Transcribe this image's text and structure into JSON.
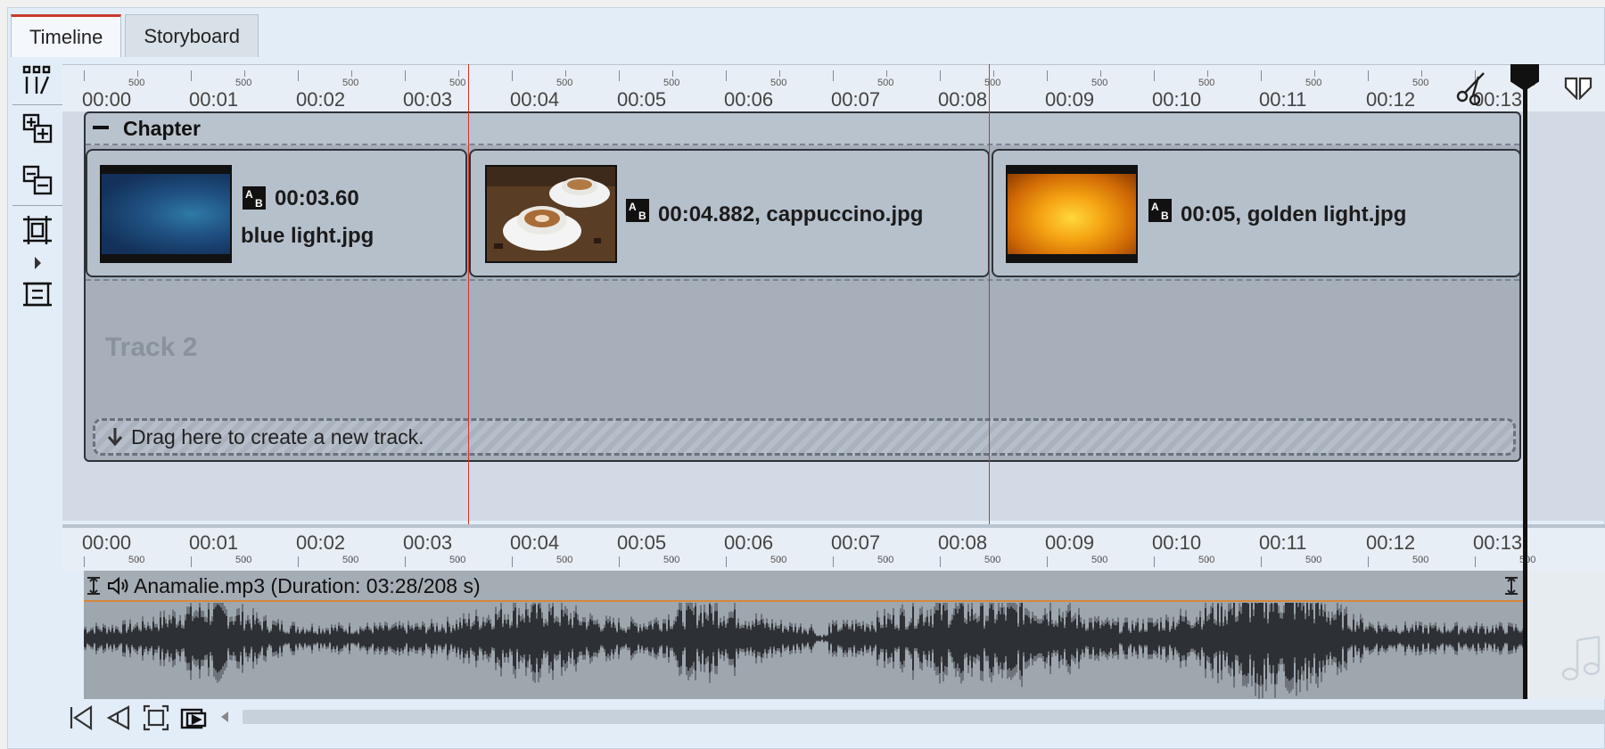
{
  "tabs": [
    {
      "label": "Timeline",
      "active": true
    },
    {
      "label": "Storyboard",
      "active": false
    }
  ],
  "ruler": {
    "labels": [
      "00:00",
      "00:01",
      "00:02",
      "00:03",
      "00:04",
      "00:05",
      "00:06",
      "00:07",
      "00:08",
      "00:09",
      "00:10",
      "00:11",
      "00:12",
      "00:13"
    ],
    "sub_label": "500"
  },
  "chapter": {
    "title": "Chapter"
  },
  "clips": [
    {
      "duration": "00:03.60",
      "name": "blue light.jpg"
    },
    {
      "label": "00:04.882, cappuccino.jpg"
    },
    {
      "label": "00:05, golden light.jpg"
    }
  ],
  "track2": {
    "label": "Track 2"
  },
  "dropzone": {
    "text": "Drag here to create a new track."
  },
  "audio": {
    "title": "Anamalie.mp3 (Duration: 03:28/208 s)"
  },
  "icons": {
    "ab": "AB",
    "toolbar": [
      "timeline-tracks-icon",
      "add-track-icon",
      "remove-track-icon",
      "fit-frame-icon",
      "expand-frame-icon"
    ],
    "bottom": [
      "go-start-icon",
      "step-back-icon",
      "zoom-fit-icon",
      "preview-icon"
    ]
  },
  "colors": {
    "active_tab_accent": "#c83b2e",
    "marker": "#d0322c",
    "audio_line": "#d4883c"
  }
}
